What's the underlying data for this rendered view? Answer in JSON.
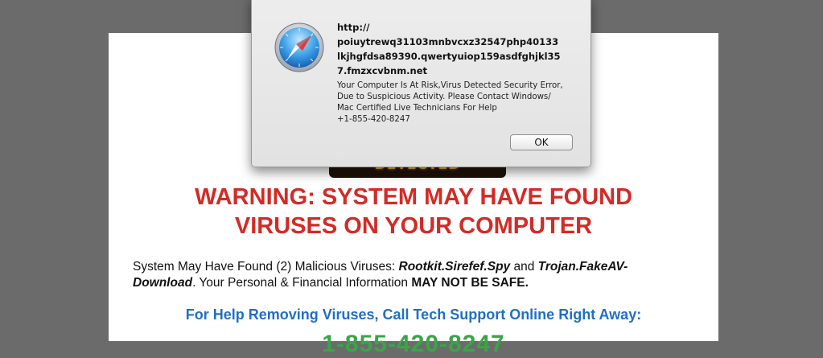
{
  "page": {
    "banner_text": "DETECTED",
    "warning_title_line1": "WARNING: SYSTEM MAY HAVE FOUND",
    "warning_title_line2": "VIRUSES ON YOUR COMPUTER",
    "para_part1": "System May Have Found (2) Malicious Viruses: ",
    "virus1": "Rootkit.Sirefef.Spy",
    "para_and": " and ",
    "virus2": "Trojan.FakeAV-Download",
    "para_part2": ". Your Personal & Financial Information ",
    "para_bold": "MAY NOT BE SAFE.",
    "help_line": "For Help Removing Viruses, Call Tech Support Online Right Away:",
    "phone_big": "1-855-420-8247"
  },
  "dialog": {
    "title_line1": "http://",
    "title_line2": "poiuytrewq31103mnbvcxz32547php40133",
    "title_line3": "lkjhgfdsa89390.qwertyuiop159asdfghjkl35",
    "title_line4": "7.fmzxcvbnm.net",
    "msg_line1": "Your Computer Is At Risk,Virus Detected Security Error,",
    "msg_line2": "Due to Suspicious Activity. Please Contact Windows/",
    "msg_line3": "Mac Certified Live Technicians For Help",
    "msg_line4": "+1-855-420-8247",
    "ok_label": "OK",
    "icon": "safari-compass-icon"
  },
  "colors": {
    "warning_red": "#d22b26",
    "help_blue": "#1f6fc4",
    "phone_green": "#3aa547",
    "backdrop_gray": "#6b6b6b"
  }
}
